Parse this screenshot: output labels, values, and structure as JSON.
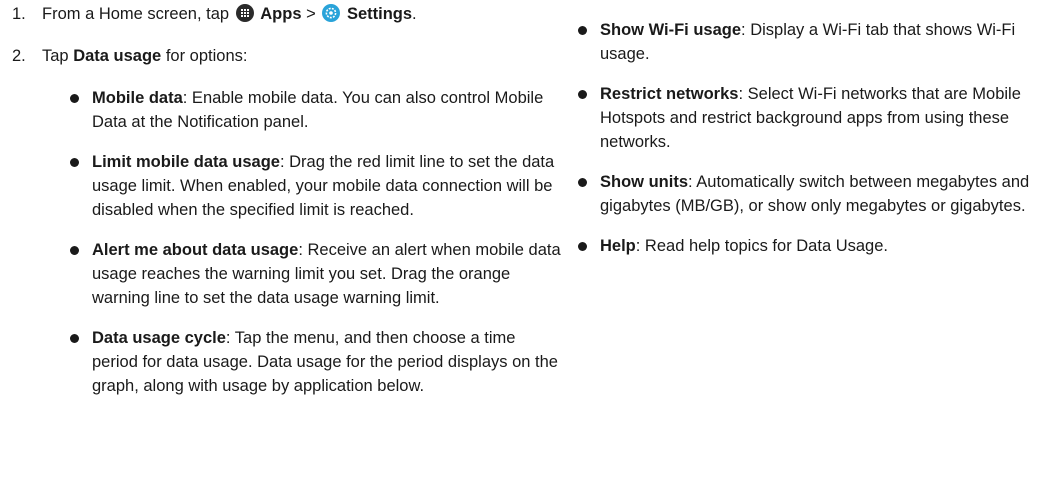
{
  "steps": [
    {
      "num": "1.",
      "pre": "From a Home screen, tap",
      "apps_label": "Apps",
      "sep": ">",
      "settings_label": "Settings",
      "post": "."
    },
    {
      "num": "2.",
      "pre": "Tap",
      "bold": "Data usage",
      "post": " for options:"
    }
  ],
  "left_bullets": [
    {
      "term": "Mobile data",
      "desc": ": Enable mobile data. You can also control Mobile Data at the Notification panel."
    },
    {
      "term": "Limit mobile data usage",
      "desc": ": Drag the red limit line to set the data usage limit. When enabled, your mobile data connection will be disabled when the specified limit is reached."
    },
    {
      "term": "Alert me about data usage",
      "desc": ": Receive an alert when mobile data usage reaches the warning limit you set. Drag the orange warning line to set the data usage warning limit."
    },
    {
      "term": "Data usage cycle",
      "desc": ": Tap the menu, and then choose a time period for data usage. Data usage for the period displays on the graph, along with usage by application below."
    }
  ],
  "right_bullets": [
    {
      "term": "Show Wi-Fi usage",
      "desc": ": Display a Wi-Fi tab that shows Wi-Fi usage."
    },
    {
      "term": "Restrict networks",
      "desc": ": Select Wi-Fi networks that are Mobile Hotspots and restrict background apps from using these networks."
    },
    {
      "term": "Show units",
      "desc": ": Automatically switch between megabytes and gigabytes (MB/GB), or show only megabytes or gigabytes."
    },
    {
      "term": "Help",
      "desc": ": Read help topics for Data Usage."
    }
  ],
  "icons": {
    "apps": "apps-grid-icon",
    "settings": "settings-gear-icon"
  },
  "colors": {
    "settings_icon": "#29a3d9",
    "apps_icon": "#2b2b2b"
  }
}
